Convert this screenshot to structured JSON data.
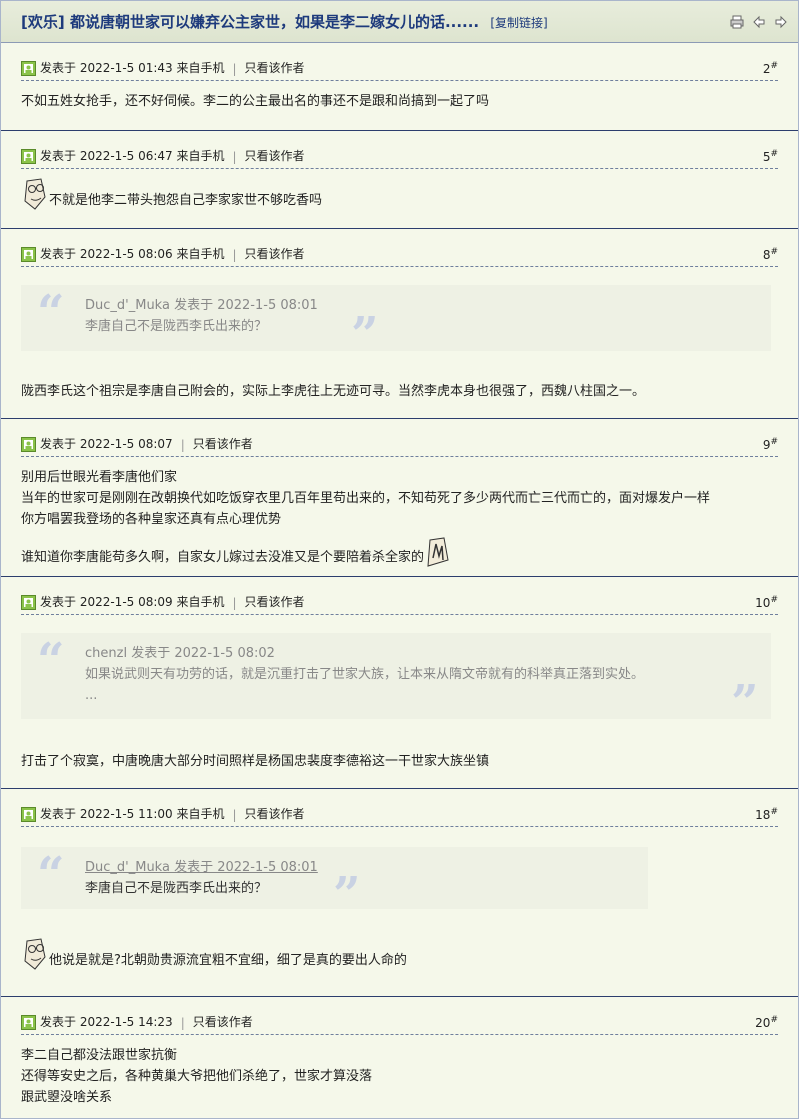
{
  "thread": {
    "tag": "[欢乐]",
    "title": " 都说唐朝世家可以嫌弃公主家世，如果是李二嫁女儿的话......",
    "copy_link": "[复制链接]",
    "icons": [
      "print-icon",
      "previous-icon",
      "next-icon"
    ]
  },
  "only_author_label": "只看该作者",
  "posts": [
    {
      "meta": "发表于 2022-1-5 01:43 来自手机",
      "floor": "2",
      "lines": [
        "不如五姓女抢手，还不好伺候。李二的公主最出名的事还不是跟和尚搞到一起了吗"
      ]
    },
    {
      "meta": "发表于 2022-1-5 06:47 来自手机",
      "floor": "5",
      "emoticon": "glasses-face-emoticon",
      "lines": [
        "不就是他李二带头抱怨自己李家家世不够吃香吗"
      ]
    },
    {
      "meta": "发表于 2022-1-5 08:06 来自手机",
      "floor": "8",
      "quote": {
        "author": "Duc_d'_Muka 发表于 2022-1-5 08:01",
        "text": "李唐自己不是陇西李氏出来的？"
      },
      "lines": [
        "陇西李氏这个祖宗是李唐自己附会的，实际上李虎往上无迹可寻。当然李虎本身也很强了，西魏八柱国之一。"
      ]
    },
    {
      "meta": "发表于 2022-1-5 08:07",
      "floor": "9",
      "lines": [
        "别用后世眼光看李唐他们家",
        "当年的世家可是刚刚在改朝换代如吃饭穿衣里几百年里苟出来的，不知苟死了多少两代而亡三代而亡的，面对爆发户一样",
        "你方唱罢我登场的各种皇家还真有点心理优势",
        "谁知道你李唐能苟多久啊，自家女儿嫁过去没准又是个要陪着杀全家的"
      ],
      "emoticon": "hand-wave-emoticon"
    },
    {
      "meta": "发表于 2022-1-5 08:09 来自手机",
      "floor": "10",
      "quote": {
        "author": "chenzl 发表于 2022-1-5 08:02",
        "text": "如果说武则天有功劳的话，就是沉重打击了世家大族，让本来从隋文帝就有的科举真正落到实处。",
        "more": "..."
      },
      "lines": [
        "打击了个寂寞，中唐晚唐大部分时间照样是杨国忠裴度李德裕这一干世家大族坐镇"
      ]
    },
    {
      "meta": "发表于 2022-1-5 11:00 来自手机",
      "floor": "18",
      "quote": {
        "author": "Duc_d'_Muka 发表于 2022-1-5 08:01",
        "text": "李唐自己不是陇西李氏出来的？"
      },
      "emoticon": "glasses-face-emoticon",
      "lines": [
        "他说是就是?北朝勋贵源流宜粗不宜细，细了是真的要出人命的"
      ]
    },
    {
      "meta": "发表于 2022-1-5 14:23",
      "floor": "20",
      "lines": [
        "李二自己都没法跟世家抗衡",
        "还得等安史之后，各种黄巢大爷把他们杀绝了，世家才算没落",
        "跟武曌没啥关系"
      ]
    }
  ],
  "colors": {
    "title": "#1d3a7c",
    "background": "#f5f8ea",
    "quote_bg": "#eef1e4"
  }
}
